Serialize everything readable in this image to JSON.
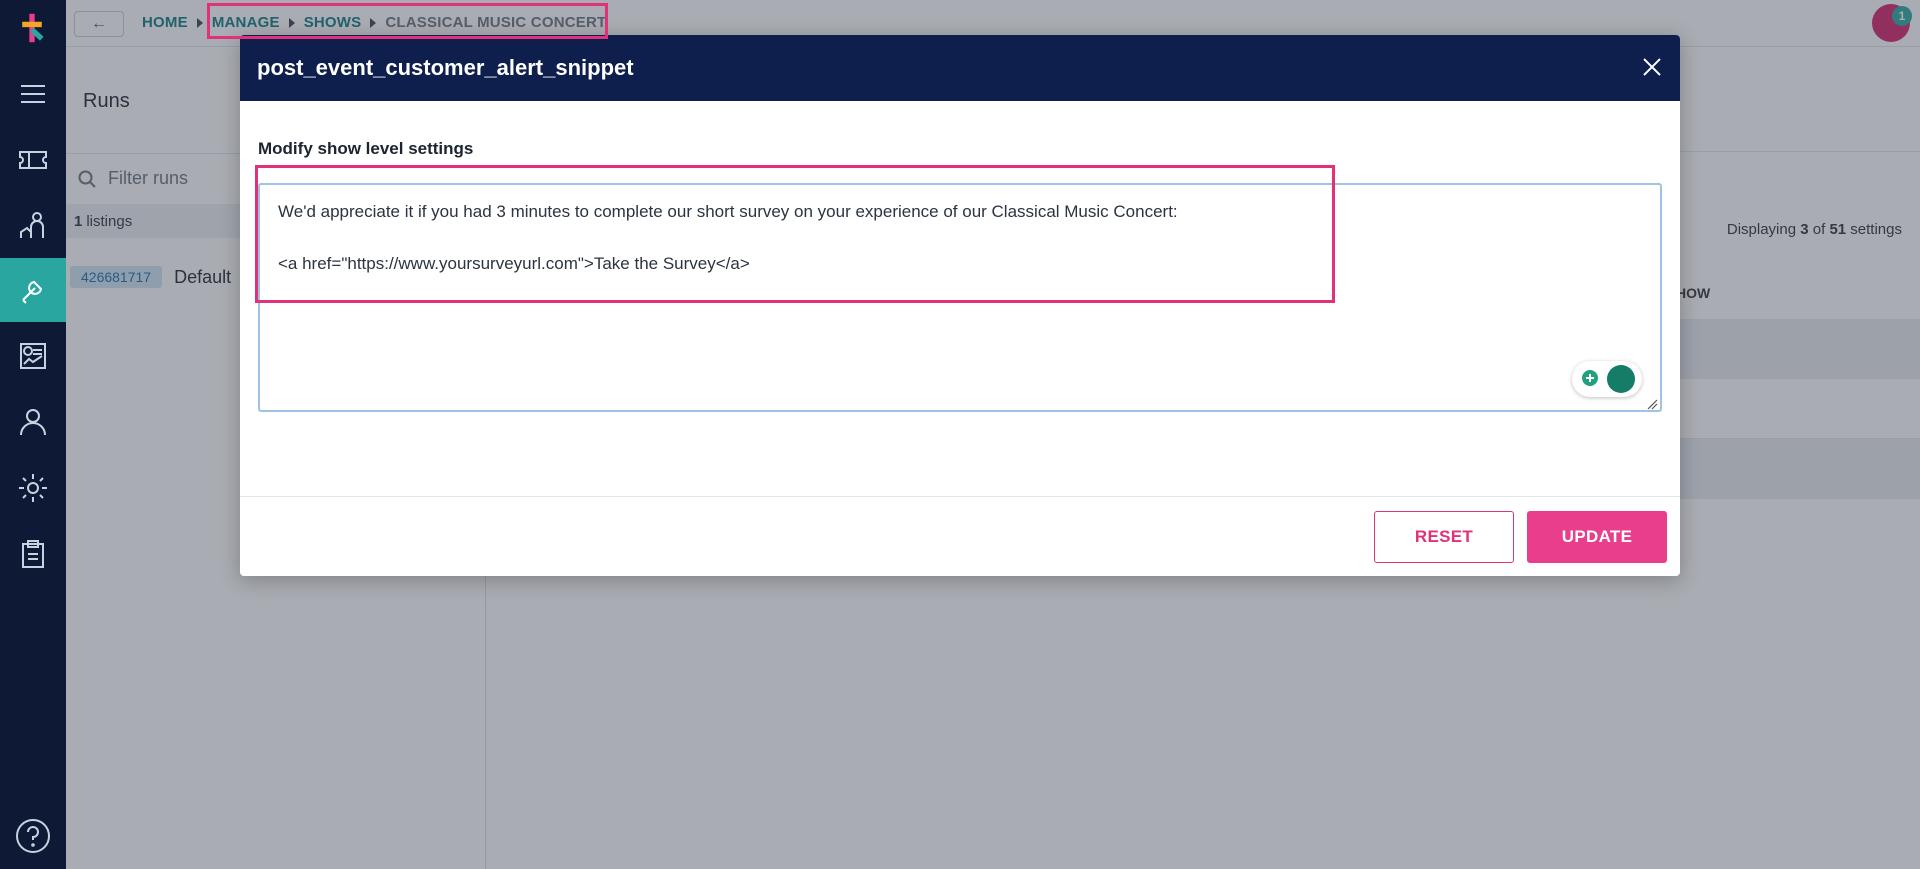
{
  "breadcrumb": {
    "items": [
      "HOME",
      "MANAGE",
      "SHOWS",
      "CLASSICAL MUSIC CONCERT"
    ]
  },
  "notifications": {
    "count": "1"
  },
  "runs": {
    "title": "Runs",
    "filter_placeholder": "Filter runs",
    "listing_count": "1",
    "listing_label": "listings",
    "items": [
      {
        "id": "426681717",
        "name": "Default"
      }
    ]
  },
  "settings": {
    "display_prefix": "Displaying",
    "display_shown": "3",
    "display_of": "of",
    "display_total": "51",
    "display_suffix": "settings",
    "column_header": "HOW"
  },
  "modal": {
    "title": "post_event_customer_alert_snippet",
    "section_label": "Modify show level settings",
    "text_line1": "We'd appreciate it if you had 3 minutes to complete our short survey on your experience of our Classical Music Concert:",
    "text_line2": "<a href=\"https://www.yoursurveyurl.com\">Take the Survey</a>",
    "reset_label": "RESET",
    "update_label": "UPDATE"
  },
  "colors": {
    "rail": "#0e1a35",
    "accent_teal": "#2aa6a0",
    "modal_header": "#0e1f4d",
    "primary_pink": "#e83e8c",
    "highlight": "#e0327a"
  }
}
